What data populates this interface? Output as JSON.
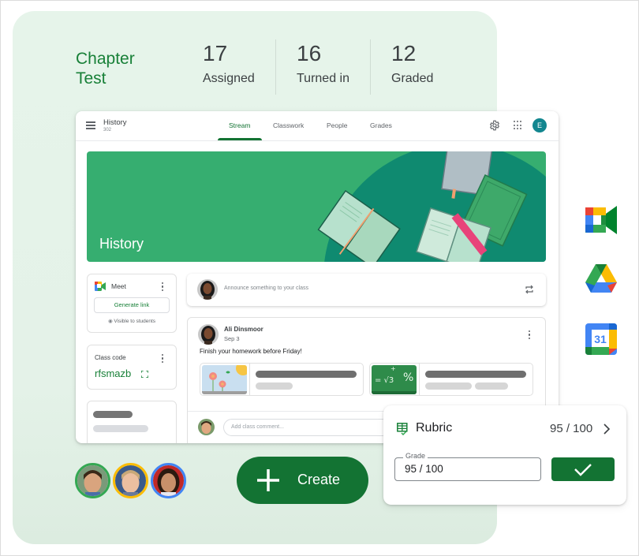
{
  "assignment": {
    "title_line1": "Chapter",
    "title_line2": "Test",
    "stats": [
      {
        "value": "17",
        "label": "Assigned"
      },
      {
        "value": "16",
        "label": "Turned in"
      },
      {
        "value": "12",
        "label": "Graded"
      }
    ]
  },
  "classroom": {
    "class_name": "History",
    "class_section": "302",
    "tabs": [
      {
        "label": "Stream",
        "active": true
      },
      {
        "label": "Classwork",
        "active": false
      },
      {
        "label": "People",
        "active": false
      },
      {
        "label": "Grades",
        "active": false
      }
    ],
    "account_initial": "E",
    "banner_title": "History",
    "meet": {
      "label": "Meet",
      "generate_link": "Generate link",
      "visibility": "Visible to students"
    },
    "class_code": {
      "label": "Class code",
      "value": "rfsmazb"
    },
    "announce_placeholder": "Announce something to your class",
    "post": {
      "author": "Ali Dinsmoor",
      "date": "Sep 3",
      "body": "Finish your homework before Friday!",
      "comment_placeholder": "Add class comment..."
    }
  },
  "rubric": {
    "label": "Rubric",
    "score": "95 / 100",
    "grade_label": "Grade",
    "grade_value": "95 / 100"
  },
  "create_button": {
    "label": "Create"
  },
  "student_avatars": [
    {
      "ring_color": "#34a853"
    },
    {
      "ring_color": "#fbbc04"
    },
    {
      "ring_color": "#4285f4"
    }
  ],
  "integrations": [
    "Google Meet",
    "Google Drive",
    "Google Calendar"
  ],
  "calendar_day": "31",
  "colors": {
    "brand_green": "#137333",
    "title_green": "#188038",
    "banner_green": "#36ae70",
    "card_bg": "#e6f4ea"
  }
}
